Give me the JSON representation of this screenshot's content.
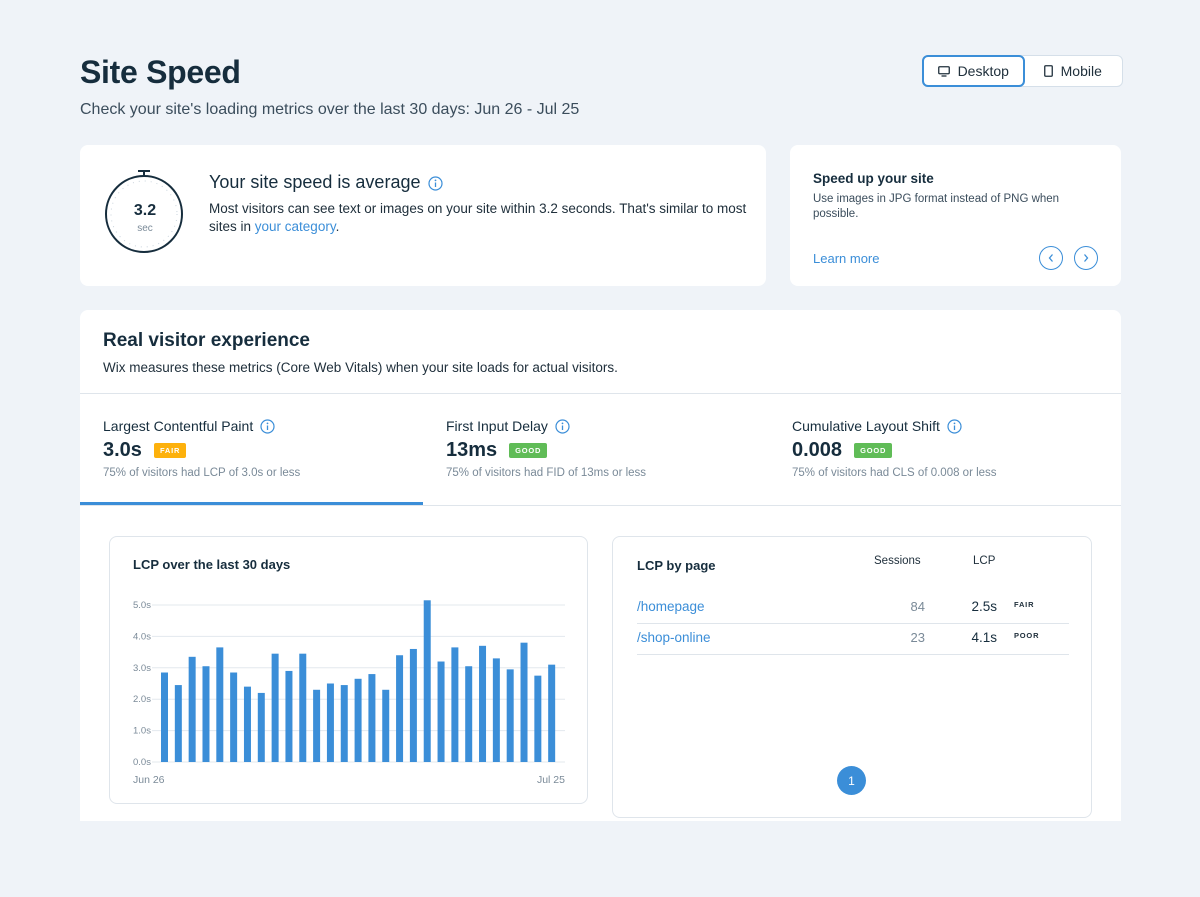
{
  "header": {
    "title": "Site Speed",
    "subtitle": "Check your site's loading metrics over the last 30 days: Jun 26 - Jul 25"
  },
  "device_toggle": {
    "desktop_label": "Desktop",
    "mobile_label": "Mobile",
    "selected": "Desktop"
  },
  "speed_summary": {
    "value": "3.2",
    "unit": "sec",
    "heading": "Your site speed is average",
    "desc_before": "Most visitors can see text or images on your site within 3.2 seconds. That's similar to most sites in ",
    "desc_link": "your category",
    "desc_after": "."
  },
  "tip": {
    "title": "Speed up your site",
    "text": "Use images in JPG format instead of PNG when possible.",
    "learn_more": "Learn more",
    "prev_icon": "chevron-left-icon",
    "next_icon": "chevron-right-icon"
  },
  "real_visitor": {
    "title": "Real visitor experience",
    "subtitle": "Wix measures these metrics (Core Web Vitals) when your site loads for actual visitors.",
    "metrics": [
      {
        "name": "Largest Contentful Paint",
        "value": "3.0s",
        "badge": "FAIR",
        "badge_color": "#fdb10c",
        "note": "75% of visitors had LCP of 3.0s or less"
      },
      {
        "name": "First Input Delay",
        "value": "13ms",
        "badge": "GOOD",
        "badge_color": "#60bc57",
        "note": "75% of visitors had FID of 13ms or less"
      },
      {
        "name": "Cumulative Layout Shift",
        "value": "0.008",
        "badge": "GOOD",
        "badge_color": "#60bc57",
        "note": "75% of visitors had CLS of 0.008 or less"
      }
    ]
  },
  "lcp_by_page": {
    "title": "LCP by page",
    "col_sessions": "Sessions",
    "col_lcp": "LCP",
    "rows": [
      {
        "page": "/homepage",
        "sessions": "84",
        "lcp": "2.5s",
        "status": "FAIR"
      },
      {
        "page": "/shop-online",
        "sessions": "23",
        "lcp": "4.1s",
        "status": "POOR"
      }
    ],
    "current_page": "1"
  },
  "colors": {
    "accent": "#3b8ed8",
    "bar": "#3b8ed8",
    "fair": "#fdb10c",
    "good": "#60bc57"
  },
  "chart_data": {
    "type": "bar",
    "title": "LCP over the last 30 days",
    "x_start_label": "Jun 26",
    "x_end_label": "Jul 25",
    "yticks": [
      "0.0s",
      "1.0s",
      "2.0s",
      "3.0s",
      "4.0s",
      "5.0s"
    ],
    "ylim": [
      0,
      5
    ],
    "grid": true,
    "values": [
      2.85,
      2.45,
      3.35,
      3.05,
      3.65,
      2.85,
      2.4,
      2.2,
      3.45,
      2.9,
      3.45,
      2.3,
      2.5,
      2.45,
      2.65,
      2.8,
      2.3,
      3.4,
      3.6,
      5.15,
      3.2,
      3.65,
      3.05,
      3.7,
      3.3,
      2.95,
      3.8,
      2.75,
      3.1
    ]
  }
}
